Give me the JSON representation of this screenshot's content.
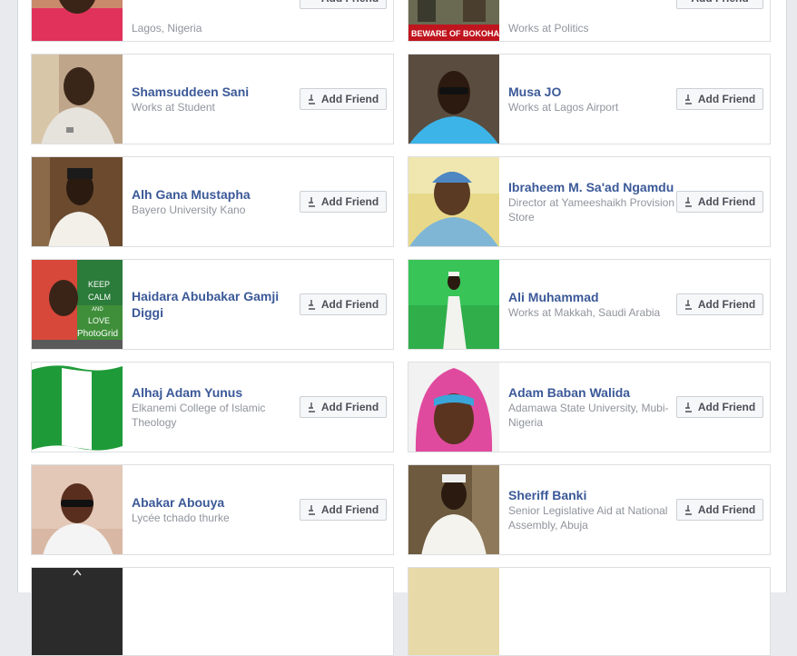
{
  "add_friend_label": "Add Friend",
  "works_at_prefix": "Works at",
  "cards_top": [
    {
      "sub": "Lagos, Nigeria"
    },
    {
      "sub_prefix": "Works at",
      "sub": "Politics",
      "photo_text": "BEWARE OF BOKOHARI"
    }
  ],
  "cards": [
    {
      "name": "Shamsuddeen Sani",
      "sub_prefix": "Works at",
      "sub": "Student"
    },
    {
      "name": "Musa JO",
      "sub_prefix": "Works at",
      "sub": "Lagos Airport"
    },
    {
      "name": "Alh Gana Mustapha",
      "sub": "Bayero University Kano"
    },
    {
      "name": "Ibraheem M. Sa'ad Ngamdu",
      "sub_prefix": "Director at",
      "sub": "Yameeshaikh Provision Store"
    },
    {
      "name": "Haidara Abubakar Gamji Diggi",
      "photo_lines": [
        "KEEP",
        "CALM",
        "AND",
        "LOVE",
        "PhotoGrid"
      ]
    },
    {
      "name": "Ali Muhammad",
      "sub_prefix": "Works at",
      "sub": "Makkah, Saudi Arabia"
    },
    {
      "name": "Alhaj Adam Yunus",
      "sub": "Elkanemi College of Islamic Theology"
    },
    {
      "name": "Adam Baban Walida",
      "sub": "Adamawa State University, Mubi-Nigeria"
    },
    {
      "name": "Abakar Abouya",
      "sub": "Lycée tchado thurke"
    },
    {
      "name": "Sheriff Banki",
      "sub_prefix": "Senior Legislative Aid at",
      "sub": "National Assembly, Abuja"
    }
  ]
}
